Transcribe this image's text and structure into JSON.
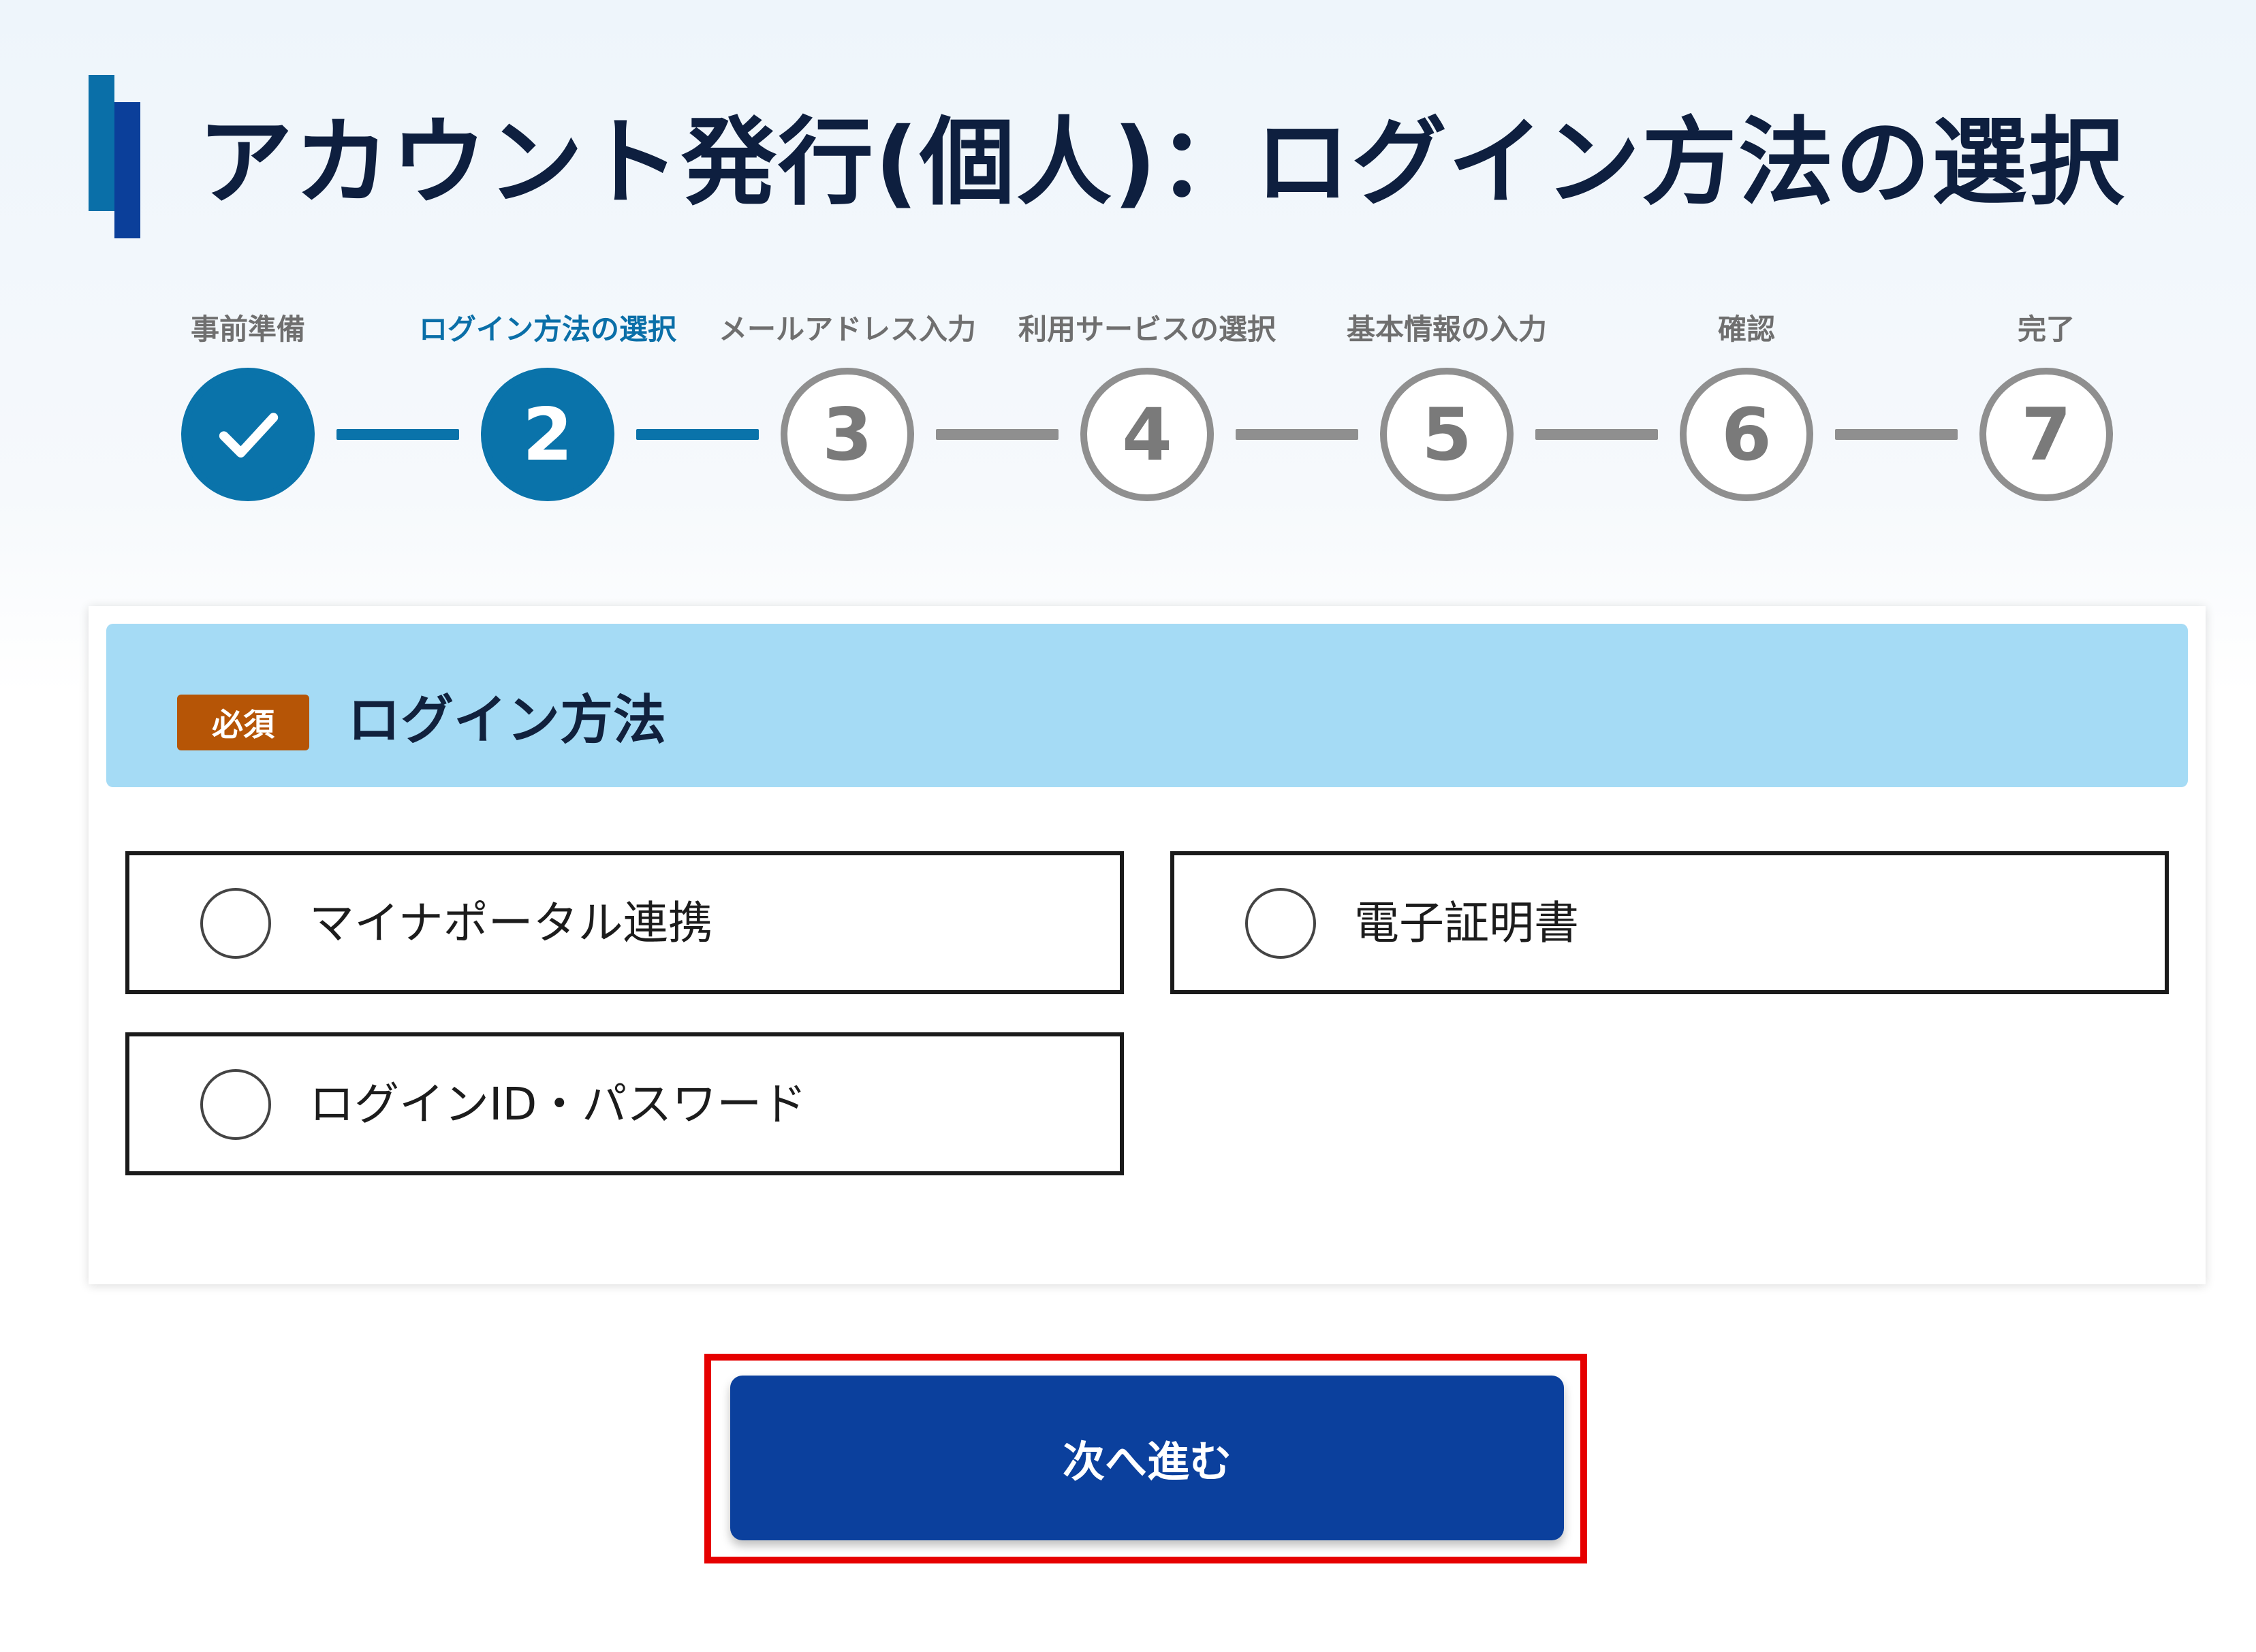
{
  "page": {
    "title": "アカウント発行(個人)：ログイン方法の選択"
  },
  "stepper": {
    "steps": [
      {
        "label": "事前準備",
        "number": "",
        "state": "done"
      },
      {
        "label": "ログイン方法の選択",
        "number": "2",
        "state": "current"
      },
      {
        "label": "メールアドレス入力",
        "number": "3",
        "state": "todo"
      },
      {
        "label": "利用サービスの選択",
        "number": "4",
        "state": "todo"
      },
      {
        "label": "基本情報の入力",
        "number": "5",
        "state": "todo"
      },
      {
        "label": "確認",
        "number": "6",
        "state": "todo"
      },
      {
        "label": "完了",
        "number": "7",
        "state": "todo"
      }
    ]
  },
  "section": {
    "required_badge": "必須",
    "title": "ログイン方法",
    "options": [
      {
        "label": "マイナポータル連携",
        "selected": false
      },
      {
        "label": "電子証明書",
        "selected": false
      },
      {
        "label": "ログインID・パスワード",
        "selected": false
      }
    ]
  },
  "actions": {
    "next_label": "次へ進む"
  },
  "colors": {
    "primary_blue": "#0b409d",
    "step_blue": "#0a73aa",
    "step_gray": "#8f8f8f",
    "header_light_blue": "#a5dbf5",
    "required_badge": "#b65506",
    "highlight_red": "#e60000"
  }
}
